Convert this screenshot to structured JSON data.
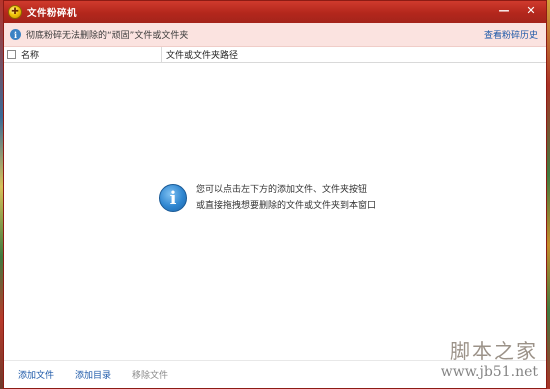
{
  "window": {
    "title": "文件粉碎机",
    "controls": {
      "minimize": "—",
      "close": "✕"
    }
  },
  "infobar": {
    "message": "彻底粉碎无法删除的“顽固”文件或文件夹",
    "history_link": "查看粉碎历史"
  },
  "table": {
    "columns": [
      "名称",
      "文件或文件夹路径"
    ],
    "rows": []
  },
  "empty_state": {
    "line1": "您可以点击左下方的添加文件、文件夹按钮",
    "line2": "或直接拖拽想要删除的文件或文件夹到本窗口"
  },
  "footer": {
    "add_file": "添加文件",
    "add_dir": "添加目录",
    "remove_file": "移除文件"
  },
  "watermark": {
    "top": "脚本之家",
    "bottom": "www.jb51.net"
  },
  "colors": {
    "titlebar": "#b3271c",
    "infobar_bg": "#fbe3e0",
    "link": "#1c58a8",
    "disabled": "#8a8a8a"
  }
}
